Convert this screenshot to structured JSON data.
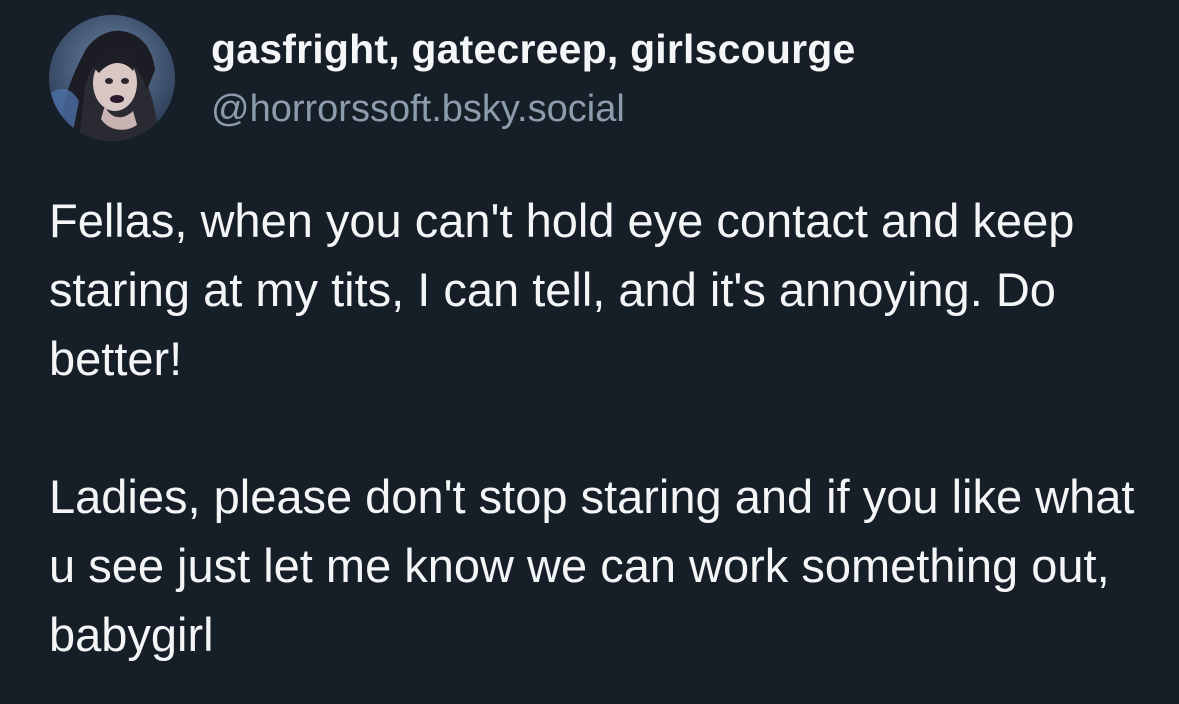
{
  "post": {
    "author": {
      "display_name": "gasfright, gatecreep, girlscourge",
      "handle": "@horrorssoft.bsky.social",
      "avatar_icon": "user-avatar-photo"
    },
    "paragraphs": [
      "Fellas, when you can't hold eye contact and keep staring at my tits, I can tell, and it's annoying. Do better!",
      "Ladies, please don't stop staring and if you like what u see just let me know we can work something out, babygirl"
    ]
  },
  "colors": {
    "background": "#161e27",
    "text": "#f3f5f7",
    "handle": "#8d9cad"
  }
}
